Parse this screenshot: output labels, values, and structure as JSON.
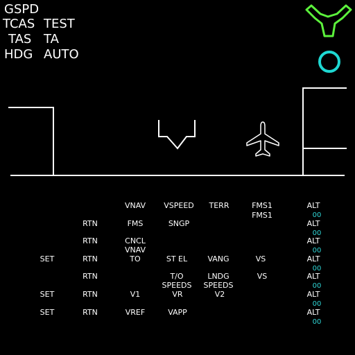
{
  "status": {
    "gspd": "GSPD",
    "tcas": "TCAS",
    "tcas_val": "TEST",
    "tas": "TAS",
    "tas_val": "TA",
    "hdg": "HDG",
    "hdg_val": "AUTO"
  },
  "colors": {
    "accent_green": "#5cf23c",
    "accent_cyan": "#1ed8d2",
    "line": "#ffffff"
  },
  "icons": {
    "top_right": "y-shape-icon",
    "circle": "circle-icon",
    "aircraft": "airplane-icon",
    "chevron": "chevron-marker-icon"
  },
  "menu": {
    "r1": {
      "c3": "VNAV",
      "c4": "VSPEED",
      "c5": "TERR",
      "c6": "FMS1",
      "c6b": "FMS1",
      "alt": "ALT",
      "alt_val": "00"
    },
    "r2": {
      "c2": "RTN",
      "c3": "FMS",
      "c4": "SNGP",
      "alt": "ALT",
      "alt_val": "00"
    },
    "r3": {
      "c2": "RTN",
      "c3": "CNCL",
      "c3b": "VNAV",
      "alt": "ALT",
      "alt_val": "00"
    },
    "r4": {
      "c1": "SET",
      "c2": "RTN",
      "c3": "TO",
      "c4": "ST   EL",
      "c5": "VANG",
      "c6": "VS",
      "alt": "ALT",
      "alt_val": "00"
    },
    "r5": {
      "c2": "RTN",
      "c4": "T/O",
      "c4b": "SPEEDS",
      "c5": "LNDG",
      "c5b": "SPEEDS",
      "c6": "VS",
      "alt": "ALT",
      "alt_val": "00"
    },
    "r6": {
      "c1": "SET",
      "c2": "RTN",
      "c3": "V1",
      "c4": "VR",
      "c5": "V2",
      "alt": "ALT",
      "alt_val": "00"
    },
    "r7": {
      "c1": "SET",
      "c2": "RTN",
      "c3": "VREF",
      "c4": "VAPP",
      "alt": "ALT",
      "alt_val": "00"
    }
  }
}
